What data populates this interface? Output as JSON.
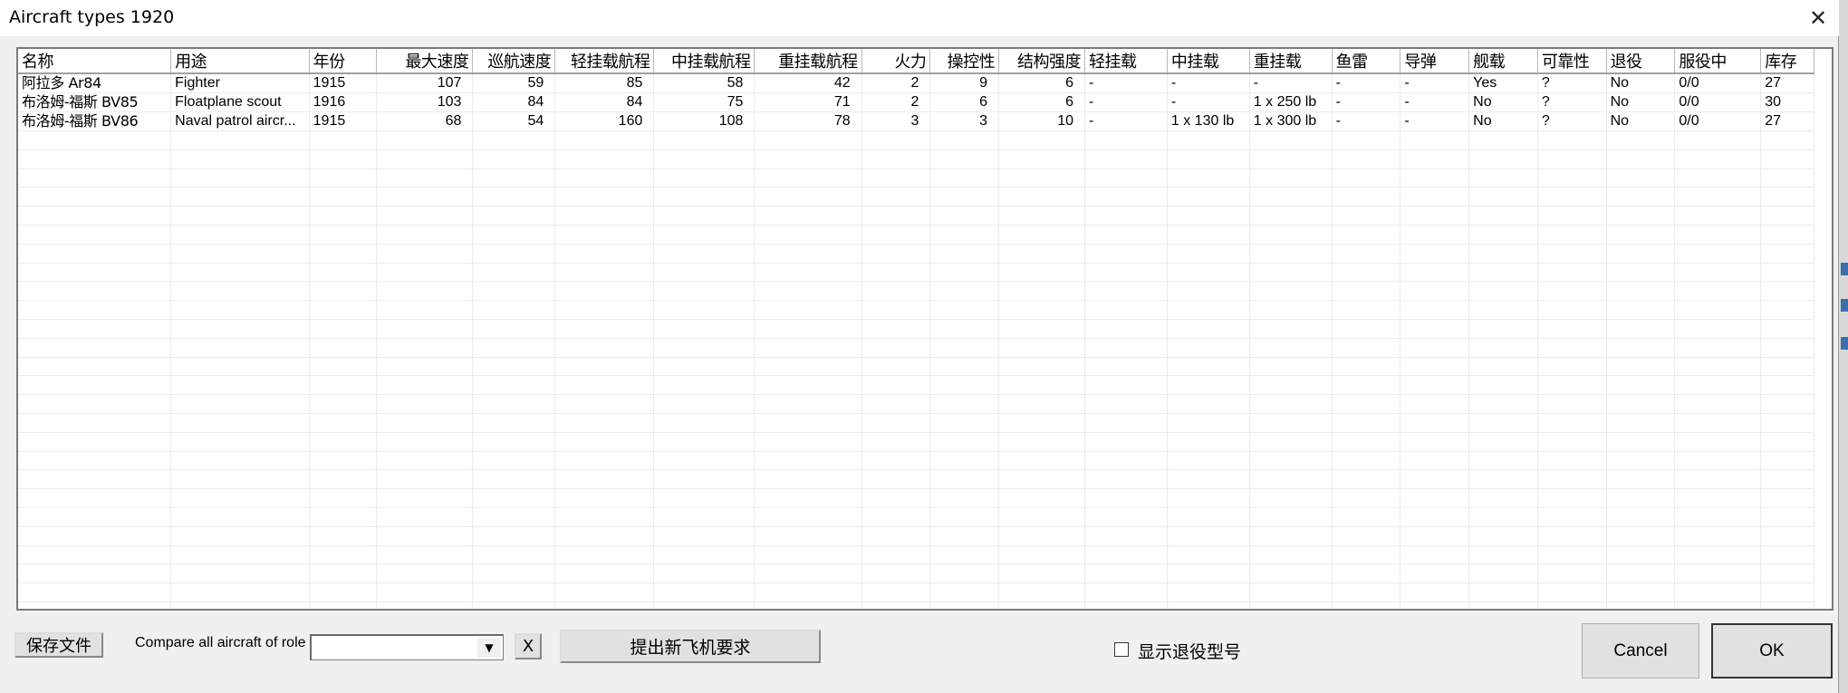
{
  "window": {
    "title": "Aircraft types 1920",
    "close_icon": "close-icon"
  },
  "table": {
    "columns": [
      "名称",
      "用途",
      "年份",
      "最大速度",
      "巡航速度",
      "轻挂载航程",
      "中挂载航程",
      "重挂载航程",
      "火力",
      "操控性",
      "结构强度",
      "轻挂载",
      "中挂载",
      "重挂载",
      "鱼雷",
      "导弹",
      "舰载",
      "可靠性",
      "退役",
      "服役中",
      "库存"
    ],
    "rows": [
      [
        "阿拉多 Ar84",
        "Fighter",
        "1915",
        "107",
        "59",
        "85",
        "58",
        "42",
        "2",
        "9",
        "6",
        "-",
        "-",
        "-",
        "-",
        "-",
        "Yes",
        "?",
        "No",
        "0/0",
        "27"
      ],
      [
        "布洛姆-福斯 BV85",
        "Floatplane scout",
        "1916",
        "103",
        "84",
        "84",
        "75",
        "71",
        "2",
        "6",
        "6",
        "-",
        "-",
        "1 x 250 lb",
        "-",
        "-",
        "No",
        "?",
        "No",
        "0/0",
        "30"
      ],
      [
        "布洛姆-福斯 BV86",
        "Naval patrol aircr...",
        "1915",
        "68",
        "54",
        "160",
        "108",
        "78",
        "3",
        "3",
        "10",
        "-",
        "1 x 130 lb",
        "1 x 300 lb",
        "-",
        "-",
        "No",
        "?",
        "No",
        "0/0",
        "27"
      ]
    ]
  },
  "footer": {
    "save_label": "保存文件",
    "compare_label": "Compare all aircraft of role",
    "role_value": "",
    "clear_label": "X",
    "request_label": "提出新飞机要求",
    "show_retired_label": "显示退役型号",
    "cancel_label": "Cancel",
    "ok_label": "OK"
  }
}
